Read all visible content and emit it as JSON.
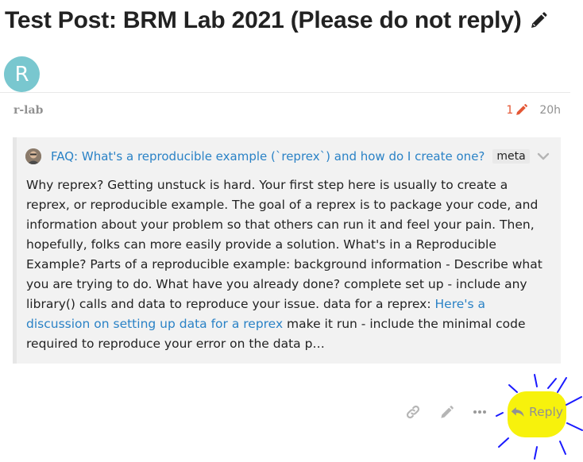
{
  "topic": {
    "title": "Test Post: BRM Lab 2021 (Please do not reply)"
  },
  "post": {
    "avatar_letter": "R",
    "username": "r-lab",
    "edit_count": "1",
    "age": "20h"
  },
  "onebox": {
    "title": "FAQ: What's a reproducible example (`reprex`) and how do I create one?",
    "tag": "meta",
    "excerpt_part1": "Why reprex? Getting unstuck is hard. Your first step here is usually to create a reprex, or reproducible example. The goal of a reprex is to package your code, and information about your problem so that others can run it and feel your pain. Then, hopefully, folks can more easily provide a solution. What's in a Reproducible Example? Parts of a reproducible example: background information - Describe what you are trying to do. What have you already done? complete set up - include any library() calls and data to reproduce your issue. data for a reprex: ",
    "excerpt_link": "Here's a discussion on setting up data for a reprex",
    "excerpt_part2": " make it run - include the minimal code required to reproduce your error on the data p…"
  },
  "actions": {
    "reply_label": "Reply",
    "icons": [
      "link-icon",
      "pencil-icon",
      "ellipsis-icon",
      "reply-icon"
    ]
  },
  "colors": {
    "link": "#2a82c6",
    "edit_accent": "#e45735",
    "muted": "#919191",
    "avatar_bg": "#79c7cf",
    "highlight": "#f7f20c",
    "scribble": "#1a1aff"
  }
}
